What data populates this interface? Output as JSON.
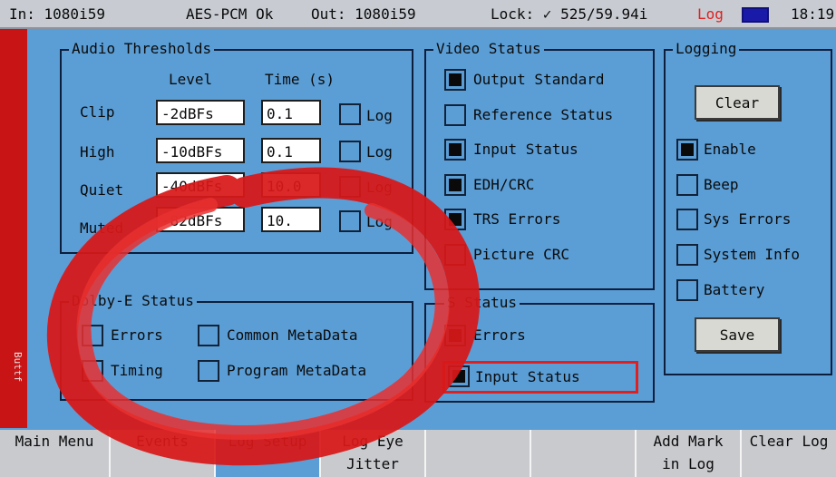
{
  "status_bar": {
    "input": "In: 1080i59",
    "audio": "AES-PCM Ok",
    "output": "Out: 1080i59",
    "lock": "Lock: ✓ 525/59.94i",
    "log": "Log",
    "time": "18:19"
  },
  "side_tab": "Buttf",
  "audio_thresholds": {
    "title": "Audio Thresholds",
    "level_header": "Level",
    "time_header": "Time (s)",
    "rows": [
      {
        "label": "Clip",
        "level": "-2dBFs",
        "time": "0.1",
        "log_label": "Log",
        "log_checked": false
      },
      {
        "label": "High",
        "level": "-10dBFs",
        "time": "0.1",
        "log_label": "Log",
        "log_checked": false
      },
      {
        "label": "Quiet",
        "level": "-40dBFs",
        "time": "10.0",
        "log_label": "Log",
        "log_checked": false
      },
      {
        "label": "Muted",
        "level": "-82dBFs",
        "time": "10.",
        "log_label": "Log",
        "log_checked": false
      }
    ]
  },
  "dolby_e_status": {
    "title": "Dolby-E Status",
    "items": [
      {
        "label": "Errors",
        "checked": false
      },
      {
        "label": "Common MetaData",
        "checked": false
      },
      {
        "label": "Timing",
        "checked": false
      },
      {
        "label": "Program MetaData",
        "checked": false
      }
    ]
  },
  "video_status": {
    "title": "Video Status",
    "items": [
      {
        "label": "Output Standard",
        "checked": true
      },
      {
        "label": "Reference Status",
        "checked": false
      },
      {
        "label": "Input Status",
        "checked": true
      },
      {
        "label": "EDH/CRC",
        "checked": true
      },
      {
        "label": "TRS Errors",
        "checked": true
      },
      {
        "label": "Picture CRC",
        "checked": false
      }
    ]
  },
  "es_status": {
    "title": "S Status",
    "items": [
      {
        "label": "Errors",
        "checked": true
      },
      {
        "label": "Input Status",
        "checked": true
      }
    ]
  },
  "logging": {
    "title": "Logging",
    "clear_label": "Clear",
    "save_label": "Save",
    "items": [
      {
        "label": "Enable",
        "checked": true
      },
      {
        "label": "Beep",
        "checked": false
      },
      {
        "label": "Sys Errors",
        "checked": false
      },
      {
        "label": "System Info",
        "checked": false
      },
      {
        "label": "Battery",
        "checked": false
      }
    ]
  },
  "softkeys": [
    {
      "line1": "Main Menu",
      "line2": ""
    },
    {
      "line1": "Events",
      "line2": ""
    },
    {
      "line1": "Log Setup",
      "line2": ""
    },
    {
      "line1": "Log Eye",
      "line2": "Jitter"
    },
    {
      "line1": "",
      "line2": ""
    },
    {
      "line1": "",
      "line2": ""
    },
    {
      "line1": "Add Mark",
      "line2": "in Log"
    },
    {
      "line1": "Clear Log",
      "line2": ""
    }
  ],
  "colors": {
    "background": "#5b9ed6",
    "status_bar": "#c8ccd2",
    "log_indicator": "#e02020",
    "annotation_red": "#d81818"
  }
}
